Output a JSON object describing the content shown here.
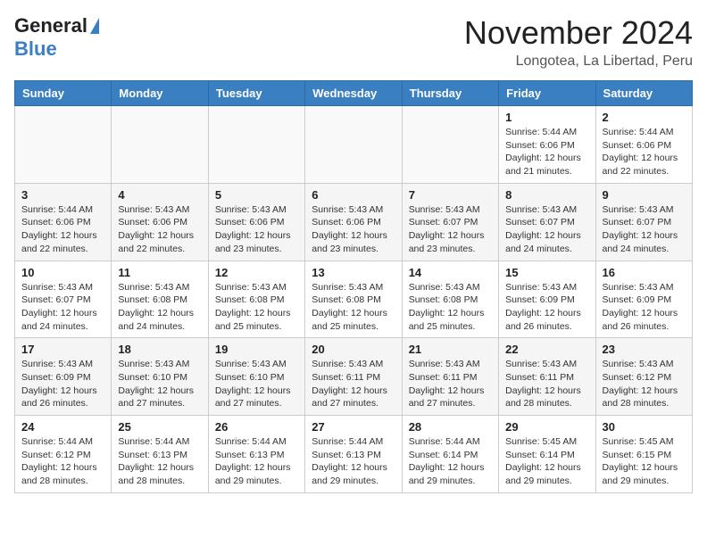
{
  "header": {
    "logo_general": "General",
    "logo_blue": "Blue",
    "month": "November 2024",
    "location": "Longotea, La Libertad, Peru"
  },
  "days_of_week": [
    "Sunday",
    "Monday",
    "Tuesday",
    "Wednesday",
    "Thursday",
    "Friday",
    "Saturday"
  ],
  "weeks": [
    [
      {
        "day": "",
        "info": ""
      },
      {
        "day": "",
        "info": ""
      },
      {
        "day": "",
        "info": ""
      },
      {
        "day": "",
        "info": ""
      },
      {
        "day": "",
        "info": ""
      },
      {
        "day": "1",
        "info": "Sunrise: 5:44 AM\nSunset: 6:06 PM\nDaylight: 12 hours and 21 minutes."
      },
      {
        "day": "2",
        "info": "Sunrise: 5:44 AM\nSunset: 6:06 PM\nDaylight: 12 hours and 22 minutes."
      }
    ],
    [
      {
        "day": "3",
        "info": "Sunrise: 5:44 AM\nSunset: 6:06 PM\nDaylight: 12 hours and 22 minutes."
      },
      {
        "day": "4",
        "info": "Sunrise: 5:43 AM\nSunset: 6:06 PM\nDaylight: 12 hours and 22 minutes."
      },
      {
        "day": "5",
        "info": "Sunrise: 5:43 AM\nSunset: 6:06 PM\nDaylight: 12 hours and 23 minutes."
      },
      {
        "day": "6",
        "info": "Sunrise: 5:43 AM\nSunset: 6:06 PM\nDaylight: 12 hours and 23 minutes."
      },
      {
        "day": "7",
        "info": "Sunrise: 5:43 AM\nSunset: 6:07 PM\nDaylight: 12 hours and 23 minutes."
      },
      {
        "day": "8",
        "info": "Sunrise: 5:43 AM\nSunset: 6:07 PM\nDaylight: 12 hours and 24 minutes."
      },
      {
        "day": "9",
        "info": "Sunrise: 5:43 AM\nSunset: 6:07 PM\nDaylight: 12 hours and 24 minutes."
      }
    ],
    [
      {
        "day": "10",
        "info": "Sunrise: 5:43 AM\nSunset: 6:07 PM\nDaylight: 12 hours and 24 minutes."
      },
      {
        "day": "11",
        "info": "Sunrise: 5:43 AM\nSunset: 6:08 PM\nDaylight: 12 hours and 24 minutes."
      },
      {
        "day": "12",
        "info": "Sunrise: 5:43 AM\nSunset: 6:08 PM\nDaylight: 12 hours and 25 minutes."
      },
      {
        "day": "13",
        "info": "Sunrise: 5:43 AM\nSunset: 6:08 PM\nDaylight: 12 hours and 25 minutes."
      },
      {
        "day": "14",
        "info": "Sunrise: 5:43 AM\nSunset: 6:08 PM\nDaylight: 12 hours and 25 minutes."
      },
      {
        "day": "15",
        "info": "Sunrise: 5:43 AM\nSunset: 6:09 PM\nDaylight: 12 hours and 26 minutes."
      },
      {
        "day": "16",
        "info": "Sunrise: 5:43 AM\nSunset: 6:09 PM\nDaylight: 12 hours and 26 minutes."
      }
    ],
    [
      {
        "day": "17",
        "info": "Sunrise: 5:43 AM\nSunset: 6:09 PM\nDaylight: 12 hours and 26 minutes."
      },
      {
        "day": "18",
        "info": "Sunrise: 5:43 AM\nSunset: 6:10 PM\nDaylight: 12 hours and 27 minutes."
      },
      {
        "day": "19",
        "info": "Sunrise: 5:43 AM\nSunset: 6:10 PM\nDaylight: 12 hours and 27 minutes."
      },
      {
        "day": "20",
        "info": "Sunrise: 5:43 AM\nSunset: 6:11 PM\nDaylight: 12 hours and 27 minutes."
      },
      {
        "day": "21",
        "info": "Sunrise: 5:43 AM\nSunset: 6:11 PM\nDaylight: 12 hours and 27 minutes."
      },
      {
        "day": "22",
        "info": "Sunrise: 5:43 AM\nSunset: 6:11 PM\nDaylight: 12 hours and 28 minutes."
      },
      {
        "day": "23",
        "info": "Sunrise: 5:43 AM\nSunset: 6:12 PM\nDaylight: 12 hours and 28 minutes."
      }
    ],
    [
      {
        "day": "24",
        "info": "Sunrise: 5:44 AM\nSunset: 6:12 PM\nDaylight: 12 hours and 28 minutes."
      },
      {
        "day": "25",
        "info": "Sunrise: 5:44 AM\nSunset: 6:13 PM\nDaylight: 12 hours and 28 minutes."
      },
      {
        "day": "26",
        "info": "Sunrise: 5:44 AM\nSunset: 6:13 PM\nDaylight: 12 hours and 29 minutes."
      },
      {
        "day": "27",
        "info": "Sunrise: 5:44 AM\nSunset: 6:13 PM\nDaylight: 12 hours and 29 minutes."
      },
      {
        "day": "28",
        "info": "Sunrise: 5:44 AM\nSunset: 6:14 PM\nDaylight: 12 hours and 29 minutes."
      },
      {
        "day": "29",
        "info": "Sunrise: 5:45 AM\nSunset: 6:14 PM\nDaylight: 12 hours and 29 minutes."
      },
      {
        "day": "30",
        "info": "Sunrise: 5:45 AM\nSunset: 6:15 PM\nDaylight: 12 hours and 29 minutes."
      }
    ]
  ]
}
